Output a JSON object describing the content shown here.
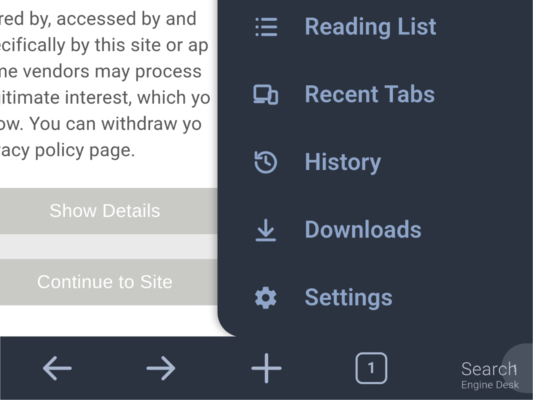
{
  "consent": {
    "body_text": "tored by, accessed by and pecifically by this site or ap ome vendors may process egitimate interest, which yo elow. You can withdraw yo rivacy policy page.",
    "show_details": "Show Details",
    "continue": "Continue to Site"
  },
  "menu": {
    "items": [
      {
        "label": "Reading List",
        "icon": "list-icon"
      },
      {
        "label": "Recent Tabs",
        "icon": "devices-icon"
      },
      {
        "label": "History",
        "icon": "history-icon"
      },
      {
        "label": "Downloads",
        "icon": "download-icon"
      },
      {
        "label": "Settings",
        "icon": "gear-icon"
      }
    ]
  },
  "toolbar": {
    "tab_count": "1"
  },
  "watermark": {
    "line1": "Search",
    "line2": "Engine Desk"
  }
}
